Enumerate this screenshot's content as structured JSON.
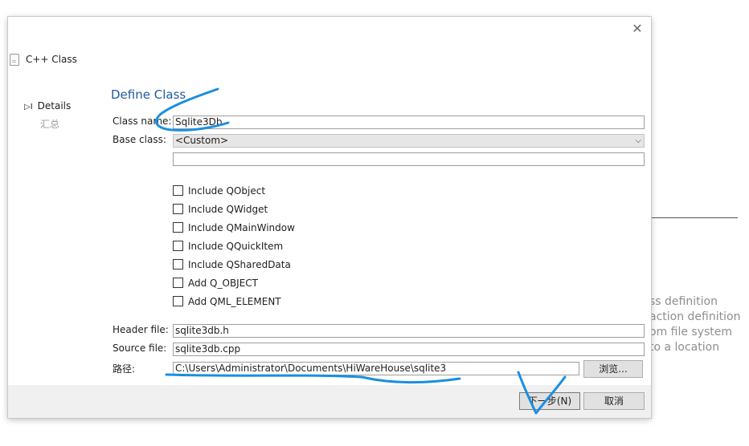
{
  "background": {
    "texts": [
      "ss definition",
      "action definition",
      "om file system",
      "to a location"
    ]
  },
  "dialog": {
    "wizard_title": "C++ Class",
    "nav": {
      "details": "Details",
      "summary": "汇总",
      "details_marker": "▷I"
    },
    "page_title": "Define Class",
    "class_name": {
      "label": "Class name:",
      "value": "Sqlite3Db"
    },
    "base_class": {
      "label": "Base class:",
      "value": "<Custom>",
      "custom_value": ""
    },
    "checkboxes": [
      {
        "label": "Include QObject",
        "checked": false
      },
      {
        "label": "Include QWidget",
        "checked": false
      },
      {
        "label": "Include QMainWindow",
        "checked": false
      },
      {
        "label": "Include QQuickItem",
        "checked": false
      },
      {
        "label": "Include QSharedData",
        "checked": false
      },
      {
        "label": "Add Q_OBJECT",
        "checked": false
      },
      {
        "label": "Add QML_ELEMENT",
        "checked": false
      }
    ],
    "header_file": {
      "label": "Header file:",
      "value": "sqlite3db.h"
    },
    "source_file": {
      "label": "Source file:",
      "value": "sqlite3db.cpp"
    },
    "path": {
      "label": "路径:",
      "value": "C:\\Users\\Administrator\\Documents\\HiWareHouse\\sqlite3",
      "browse_label": "浏览..."
    },
    "buttons": {
      "next_label": "下一步(N)",
      "cancel_label": "取消"
    },
    "close_glyph": "✕"
  },
  "annotation_color": "#1a8fe0"
}
